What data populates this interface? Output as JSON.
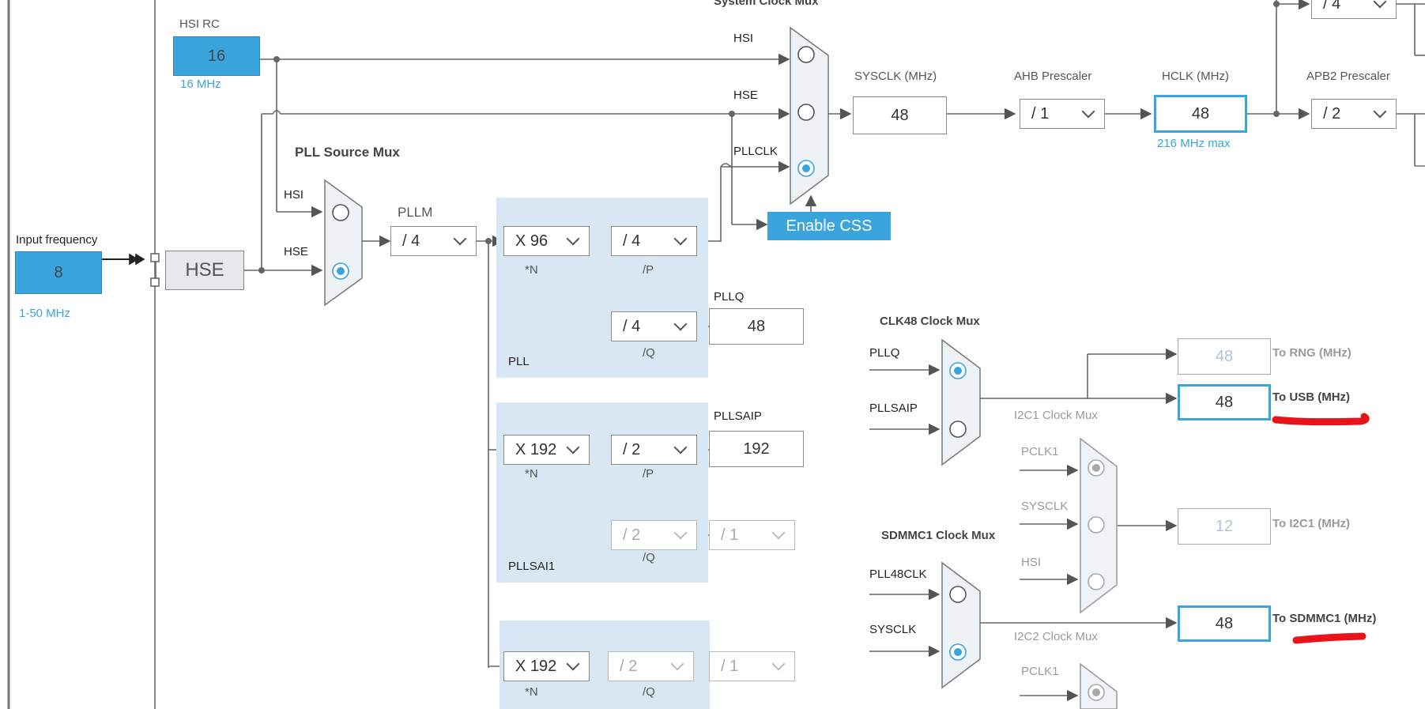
{
  "input": {
    "label": "Input frequency",
    "value": "8",
    "range": "1-50 MHz"
  },
  "hsi_rc": {
    "label": "HSI RC",
    "value": "16",
    "freq": "16 MHz"
  },
  "hse_block": {
    "label": "HSE"
  },
  "pll_source_mux": {
    "title": "PLL Source Mux",
    "inputs": [
      "HSI",
      "HSE"
    ]
  },
  "pllm": {
    "label": "PLLM",
    "value": "/ 4"
  },
  "pll": {
    "name": "PLL",
    "n_value": "X 96",
    "n_label": "*N",
    "p_value": "/ 4",
    "p_label": "/P",
    "q_value": "/ 4",
    "q_label": "/Q",
    "pllq_label": "PLLQ",
    "pllq_value": "48"
  },
  "pllsai1": {
    "name": "PLLSAI1",
    "n_value": "X 192",
    "n_label": "*N",
    "p_value": "/ 2",
    "p_label": "/P",
    "q_value": "/ 2",
    "q_label": "/Q",
    "pllsaip_label": "PLLSAIP",
    "pllsaip_value": "192",
    "div_value": "/ 1"
  },
  "plli2s": {
    "n_value": "X 192",
    "n_label": "*N",
    "q_value": "/ 2",
    "q_label": "/Q",
    "div_value": "/ 1"
  },
  "system_clock_mux": {
    "title": "System Clock Mux",
    "inputs": [
      "HSI",
      "HSE",
      "PLLCLK"
    ]
  },
  "enable_css": "Enable CSS",
  "sysclk": {
    "label": "SYSCLK (MHz)",
    "value": "48"
  },
  "ahb": {
    "label": "AHB Prescaler",
    "value": "/ 1"
  },
  "hclk": {
    "label": "HCLK (MHz)",
    "value": "48",
    "max": "216 MHz max"
  },
  "apb2": {
    "label": "APB2 Prescaler",
    "value": "/ 2"
  },
  "apb1_partial": {
    "value": "/ 4"
  },
  "clk48_mux": {
    "title": "CLK48 Clock Mux",
    "inputs": [
      "PLLQ",
      "PLLSAIP"
    ]
  },
  "rng": {
    "value": "48",
    "label": "To RNG (MHz)"
  },
  "usb": {
    "value": "48",
    "label": "To USB (MHz)"
  },
  "i2c1_mux": {
    "title": "I2C1 Clock Mux",
    "inputs": [
      "PCLK1",
      "SYSCLK",
      "HSI"
    ]
  },
  "i2c1": {
    "value": "12",
    "label": "To I2C1 (MHz)"
  },
  "sdmmc1_mux": {
    "title": "SDMMC1 Clock Mux",
    "inputs": [
      "PLL48CLK",
      "SYSCLK"
    ]
  },
  "sdmmc1": {
    "value": "48",
    "label": "To SDMMC1 (MHz)"
  },
  "i2c2_mux": {
    "title": "I2C2 Clock Mux",
    "inputs": [
      "PCLK1"
    ]
  },
  "colors": {
    "accent": "#3aa4dc",
    "pll_bg": "#d9e7f4",
    "annotation": "#e8141a",
    "wire": "#666666"
  }
}
